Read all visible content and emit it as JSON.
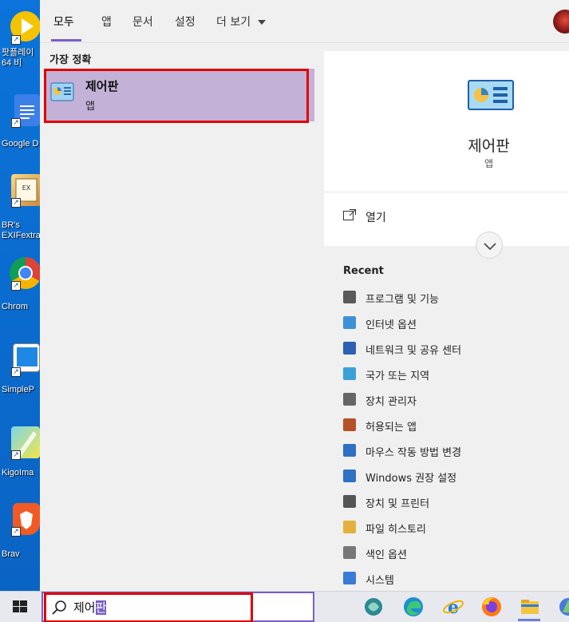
{
  "desktop": {
    "icons": [
      {
        "label": "팟플레이\n64 비",
        "icon": "potplayer-icon"
      },
      {
        "label": "Google D",
        "icon": "google-docs-icon"
      },
      {
        "label": "BR's\nEXIFextra",
        "icon": "exif-icon"
      },
      {
        "label": "Chrom",
        "icon": "chrome-icon"
      },
      {
        "label": "SimpleP",
        "icon": "simple-icon"
      },
      {
        "label": "KigoIma",
        "icon": "kigo-icon"
      },
      {
        "label": "Brav",
        "icon": "brave-icon"
      }
    ]
  },
  "tabs": [
    {
      "label": "모두",
      "active": true
    },
    {
      "label": "앱"
    },
    {
      "label": "문서"
    },
    {
      "label": "설정"
    },
    {
      "label": "더 보기"
    }
  ],
  "best_match": {
    "section_label": "가장 정확",
    "title": "제어판",
    "subtitle": "앱"
  },
  "detail": {
    "title": "제어판",
    "subtitle": "앱",
    "open_label": "열기",
    "recent_label": "Recent",
    "recent_items": [
      {
        "label": "프로그램 및 기능",
        "icon": "programs-icon",
        "color": "#5a5a5a"
      },
      {
        "label": "인터넷 옵션",
        "icon": "internet-options-icon",
        "color": "#3f8fd8"
      },
      {
        "label": "네트워크 및 공유 센터",
        "icon": "network-icon",
        "color": "#2d5fb3"
      },
      {
        "label": "국가 또는 지역",
        "icon": "globe-clock-icon",
        "color": "#3aa1d8"
      },
      {
        "label": "장치 관리자",
        "icon": "device-manager-icon",
        "color": "#666666"
      },
      {
        "label": "허용되는 앱",
        "icon": "firewall-icon",
        "color": "#b5522a"
      },
      {
        "label": "마우스 작동 방법 변경",
        "icon": "ease-of-access-icon",
        "color": "#2f6fc4"
      },
      {
        "label": "Windows 권장 설정",
        "icon": "ease-of-access-icon",
        "color": "#2f6fc4"
      },
      {
        "label": "장치 및 프린터",
        "icon": "printer-icon",
        "color": "#555555"
      },
      {
        "label": "파일 히스토리",
        "icon": "file-history-icon",
        "color": "#e3b23c"
      },
      {
        "label": "색인 옵션",
        "icon": "indexing-icon",
        "color": "#777777"
      },
      {
        "label": "시스템",
        "icon": "system-icon",
        "color": "#3a7bd5"
      }
    ]
  },
  "search": {
    "typed": "제어",
    "selected": "판"
  },
  "taskbar": {
    "apps": [
      "cortana-icon",
      "edge-icon",
      "ie-icon",
      "firefox-icon",
      "file-explorer-icon",
      "other-app-icon"
    ]
  }
}
